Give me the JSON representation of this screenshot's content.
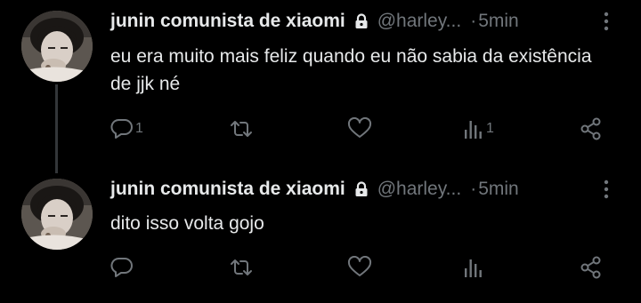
{
  "thread": [
    {
      "author": {
        "name": "junin comunista de xiaomi",
        "handle": "@harley...",
        "locked": true,
        "avatar_icon": "profile-photo"
      },
      "time": "5min",
      "separator": "·",
      "text": "eu era muito mais feliz quando eu não sabia da existência de jjk né",
      "actions": {
        "reply_count": "1",
        "retweet_count": "",
        "like_count": "",
        "views_count": "1"
      }
    },
    {
      "author": {
        "name": "junin comunista de xiaomi",
        "handle": "@harley...",
        "locked": true,
        "avatar_icon": "profile-photo"
      },
      "time": "5min",
      "separator": "·",
      "text": "dito isso volta gojo",
      "actions": {
        "reply_count": "",
        "retweet_count": "",
        "like_count": "",
        "views_count": ""
      }
    }
  ],
  "colors": {
    "background": "#000000",
    "primary_text": "#e7e9ea",
    "secondary_text": "#71767b",
    "thread_line": "#333639"
  }
}
